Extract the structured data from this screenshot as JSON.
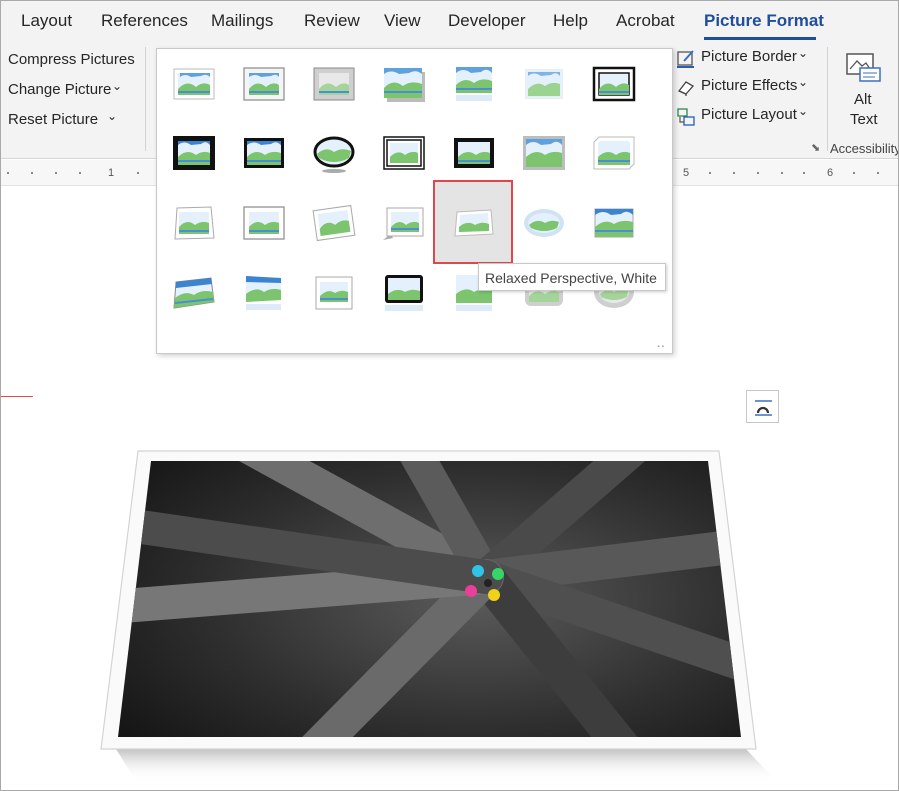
{
  "tabs": [
    {
      "id": "layout",
      "label": "Layout",
      "active": false
    },
    {
      "id": "references",
      "label": "References",
      "active": false
    },
    {
      "id": "mailings",
      "label": "Mailings",
      "active": false
    },
    {
      "id": "review",
      "label": "Review",
      "active": false
    },
    {
      "id": "view",
      "label": "View",
      "active": false
    },
    {
      "id": "developer",
      "label": "Developer",
      "active": false
    },
    {
      "id": "help",
      "label": "Help",
      "active": false
    },
    {
      "id": "acrobat",
      "label": "Acrobat",
      "active": false
    },
    {
      "id": "picture-format",
      "label": "Picture Format",
      "active": true
    }
  ],
  "ribbon": {
    "adjust": {
      "compress": "Compress Pictures",
      "change": "Change Picture",
      "reset": "Reset Picture"
    },
    "styles": {
      "border": "Picture Border",
      "effects": "Picture Effects",
      "layout": "Picture Layout"
    },
    "accessibility": {
      "alt_line1": "Alt",
      "alt_line2": "Text",
      "group_label": "Accessibility"
    }
  },
  "ruler": {
    "marks": [
      "1",
      "5",
      "6"
    ]
  },
  "gallery": {
    "selected": "Relaxed Perspective, White",
    "tooltip": "Relaxed Perspective, White",
    "styles": [
      "Simple Frame, White",
      "Beveled Matte, White",
      "Metal Frame",
      "Drop Shadow Rectangle",
      "Reflected Rounded Rectangle",
      "Soft Edge Rectangle",
      "Double Frame, Black",
      "Thick Matte, Black",
      "Simple Frame, Black",
      "Beveled Oval, Black",
      "Compound Frame, Black",
      "Center Shadow Rectangle",
      "Rounded Diagonal Corner, White",
      "Snip Diagonal Corner, White",
      "Moderate Frame, White",
      "Rotated, White",
      "Perspective Shadow, White",
      "Relaxed Perspective, White",
      "Soft Edge Oval",
      "Bevel Rectangle",
      "Bevel Perspective",
      "Reflected Perspective Right",
      "Bevel Perspective Left, White",
      "Reflected Bevel, White",
      "Reflected Bevel, Black",
      "Metal Rounded Rectangle",
      "Metal Oval",
      "Moderate Frame, Black"
    ]
  }
}
